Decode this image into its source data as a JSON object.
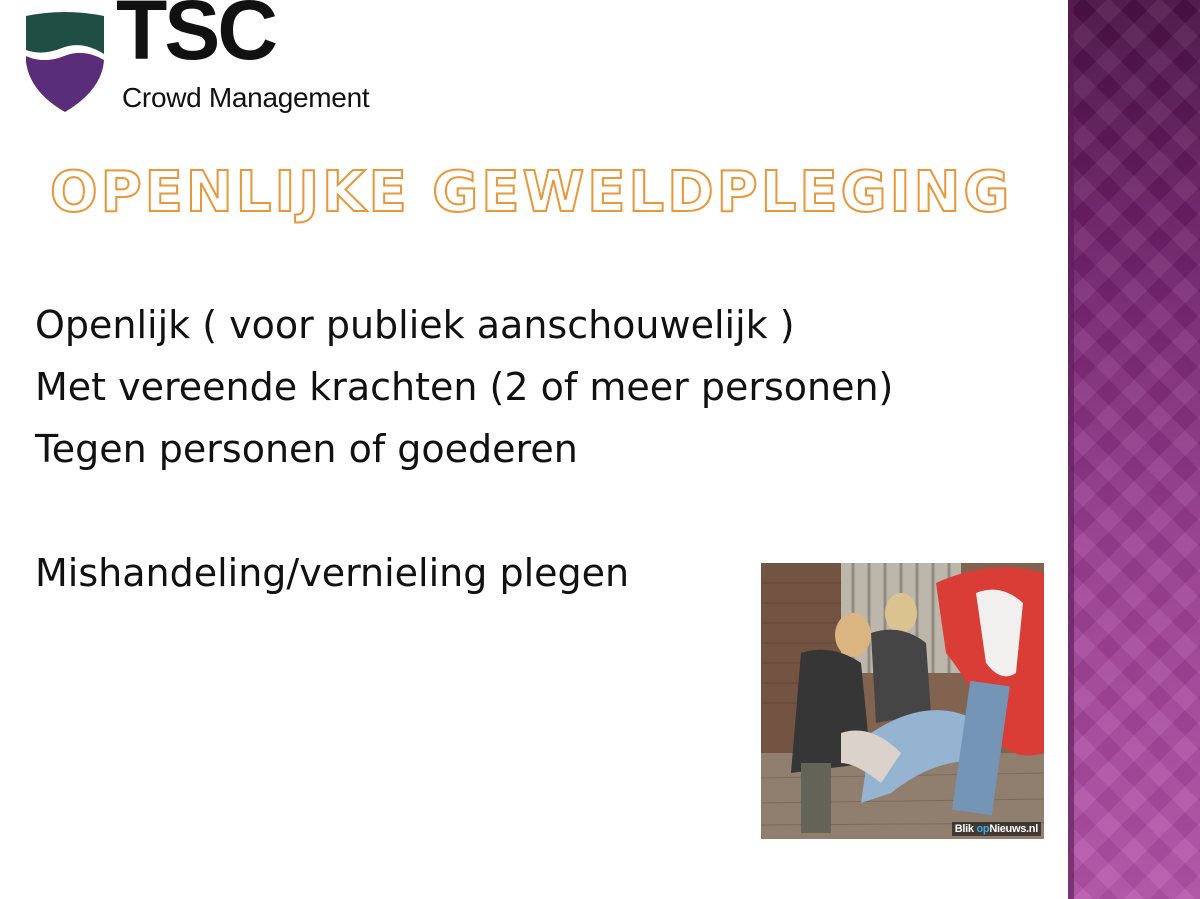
{
  "logo": {
    "brand": "TSC",
    "subtitle": "Crowd Management",
    "shield_colors": {
      "top": "#1f4f44",
      "bottom": "#5a2d7a"
    }
  },
  "slide": {
    "title": "OPENLIJKE GEWELDPLEGING",
    "title_outline_color": "#e8973a",
    "bullets": [
      "Openlijk ( voor publiek aanschouwelijk )",
      "Met vereende krachten (2 of meer personen)",
      "Tegen personen of goederen",
      "",
      "Mishandeling/vernieling plegen"
    ]
  },
  "photo": {
    "watermark_pre": "Blik ",
    "watermark_op": "op",
    "watermark_post": "Nieuws.nl"
  },
  "theme": {
    "side_band_colors": [
      "#4a1246",
      "#b453aa"
    ]
  }
}
